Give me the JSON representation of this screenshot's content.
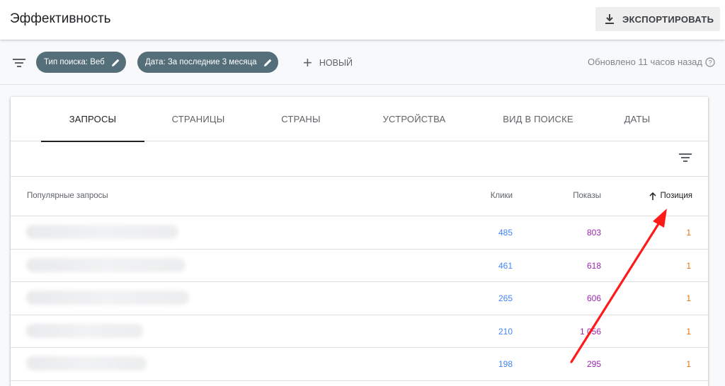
{
  "header": {
    "title": "Эффективность",
    "export_label": "ЭКСПОРТИРОВАТЬ"
  },
  "filters": {
    "chips": [
      {
        "label": "Тип поиска: Веб"
      },
      {
        "label": "Дата: За последние 3 месяца"
      }
    ],
    "new_label": "НОВЫЙ",
    "updated_text": "Обновлено 11 часов назад"
  },
  "tabs": [
    {
      "label": "ЗАПРОСЫ",
      "active": true
    },
    {
      "label": "СТРАНИЦЫ",
      "active": false
    },
    {
      "label": "СТРАНЫ",
      "active": false
    },
    {
      "label": "УСТРОЙСТВА",
      "active": false
    },
    {
      "label": "ВИД В ПОИСКЕ",
      "active": false
    },
    {
      "label": "ДАТЫ",
      "active": false
    }
  ],
  "table": {
    "columns": {
      "query": "Популярные запросы",
      "clicks": "Клики",
      "impressions": "Показы",
      "position": "Позиция"
    },
    "rows": [
      {
        "clicks": "485",
        "impressions": "803",
        "position": "1"
      },
      {
        "clicks": "461",
        "impressions": "618",
        "position": "1"
      },
      {
        "clicks": "265",
        "impressions": "606",
        "position": "1"
      },
      {
        "clicks": "210",
        "impressions": "1 056",
        "position": "1"
      },
      {
        "clicks": "198",
        "impressions": "295",
        "position": "1"
      }
    ]
  },
  "colors": {
    "clicks": "#4285f4",
    "impressions": "#9c27b0",
    "position": "#e8710a",
    "chip": "#546e7a",
    "annotation_arrow": "#ff1a1a"
  },
  "icons": [
    "download-icon",
    "filter-icon",
    "pencil-icon",
    "plus-icon",
    "help-icon",
    "sort-arrow-up-icon"
  ]
}
